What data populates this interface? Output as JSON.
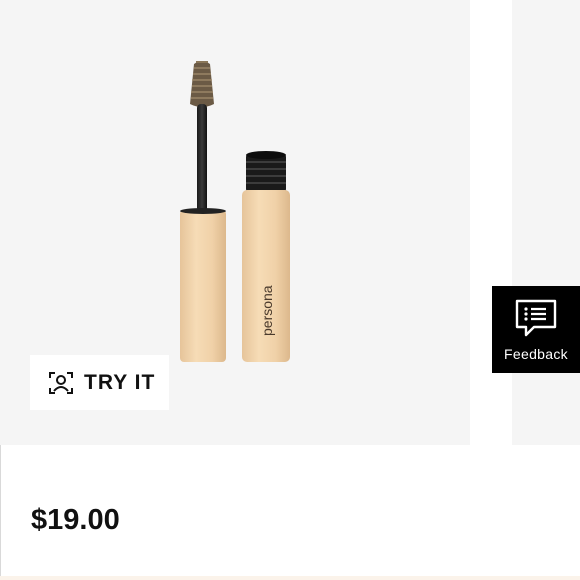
{
  "product": {
    "brand_text": "persona",
    "price": "$19.00"
  },
  "try_it": {
    "label": "TRY IT",
    "icon": "face-scan-icon"
  },
  "feedback": {
    "label": "Feedback",
    "icon": "chat-bubble-icon"
  },
  "colors": {
    "image_background": "#f5f5f5",
    "tube": "#f1d4ac",
    "feedback_background": "#000000",
    "text": "#111111"
  }
}
